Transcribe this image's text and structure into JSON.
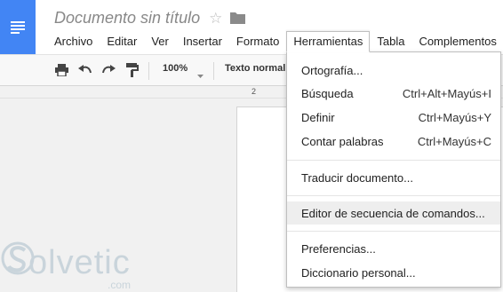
{
  "app": {
    "doc_title": "Documento sin título",
    "logo_icon": "docs-icon",
    "accent_color": "#4285f4"
  },
  "menubar": {
    "items": [
      "Archivo",
      "Editar",
      "Ver",
      "Insertar",
      "Formato",
      "Herramientas",
      "Tabla",
      "Complementos"
    ],
    "active": "Herramientas"
  },
  "toolbar": {
    "icons": [
      "print-icon",
      "undo-icon",
      "redo-icon",
      "paint-format-icon"
    ],
    "zoom": "100%",
    "style": "Texto normal"
  },
  "ruler": {
    "marker": "2"
  },
  "tools_menu": {
    "items": [
      {
        "label": "Ortografía...",
        "shortcut": ""
      },
      {
        "label": "Búsqueda",
        "shortcut": "Ctrl+Alt+Mayús+I"
      },
      {
        "label": "Definir",
        "shortcut": "Ctrl+Mayús+Y"
      },
      {
        "label": "Contar palabras",
        "shortcut": "Ctrl+Mayús+C"
      },
      {
        "label": "Traducir documento...",
        "shortcut": ""
      },
      {
        "label": "Editor de secuencia de comandos...",
        "shortcut": ""
      },
      {
        "label": "Preferencias...",
        "shortcut": ""
      },
      {
        "label": "Diccionario personal...",
        "shortcut": ""
      }
    ],
    "highlighted": "Editor de secuencia de comandos..."
  },
  "watermark": {
    "text": "olvetic",
    "suffix": ".com"
  }
}
